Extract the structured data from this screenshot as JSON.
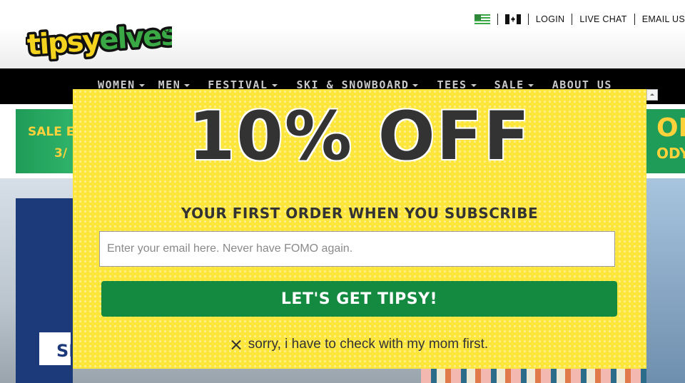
{
  "header": {
    "logo_text": "tipsyelves",
    "links": {
      "login": "LOGIN",
      "live_chat": "LIVE CHAT",
      "email": "EMAIL US"
    }
  },
  "nav": {
    "items": [
      {
        "label": "WOMEN",
        "dropdown": true
      },
      {
        "label": "MEN",
        "dropdown": true
      },
      {
        "label": "FESTIVAL",
        "dropdown": true
      },
      {
        "label": "SKI & SNOWBOARD",
        "dropdown": true
      },
      {
        "label": "TEES",
        "dropdown": true
      },
      {
        "label": "SALE",
        "dropdown": true
      },
      {
        "label": "ABOUT US",
        "dropdown": false
      }
    ]
  },
  "background": {
    "promo_left_line1": "SALE E",
    "promo_left_line2": "3/",
    "promo_right_line1": "OF",
    "promo_right_line2": "ODY",
    "hero_button_partial": "SH"
  },
  "modal": {
    "headline": "10% OFF",
    "subhead": "YOUR FIRST ORDER WHEN YOU SUBSCRIBE",
    "email_placeholder": "Enter your email here. Never have FOMO again.",
    "email_value": "",
    "cta_label": "LET'S GET TIPSY!",
    "decline_label": "sorry, i have to check with my mom first."
  },
  "colors": {
    "modal_bg": "#fce63c",
    "cta_bg": "#138a3f",
    "nav_bg": "#000000",
    "promo_green": "#1f9c57",
    "promo_yellow": "#ffd23b"
  }
}
